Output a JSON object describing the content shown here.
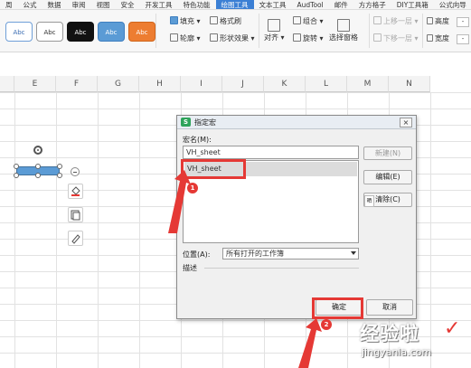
{
  "menubar": {
    "items": [
      "周",
      "公式",
      "数据",
      "审阅",
      "视图",
      "安全",
      "开发工具",
      "特色功能",
      "绘图工具",
      "文本工具",
      "AudTool",
      "邮件",
      "方方格子",
      "DIY工具箱",
      "公式向导"
    ],
    "active": "绘图工具"
  },
  "ribbon": {
    "style_presets": [
      {
        "label": "Abc",
        "bg": "#ffffff",
        "fg": "#3b6db3",
        "border": "#6f9fd8"
      },
      {
        "label": "Abc",
        "bg": "#ffffff",
        "fg": "#333333",
        "border": "#999999"
      },
      {
        "label": "Abc",
        "bg": "#111111",
        "fg": "#ffffff",
        "border": "#111111"
      },
      {
        "label": "Abc",
        "bg": "#5b9bd5",
        "fg": "#ffffff",
        "border": "#3f7fc0"
      },
      {
        "label": "Abc",
        "bg": "#ed7d31",
        "fg": "#ffffff",
        "border": "#d0651c"
      }
    ],
    "fill": "填充",
    "format_brush": "格式刷",
    "outline": "轮廓",
    "shape_effects": "形状效果",
    "align": "对齐",
    "group": "组合",
    "rotate": "旋转",
    "selection_pane": "选择窗格",
    "move_up": "上移一层",
    "move_down": "下移一层",
    "height": "高度",
    "width": "宽度",
    "height_value": "-",
    "width_value": "-"
  },
  "grid": {
    "columns": [
      "E",
      "F",
      "G",
      "H",
      "I",
      "J",
      "K",
      "L",
      "M",
      "N"
    ]
  },
  "dialog": {
    "title": "指定宏",
    "close": "×",
    "macro_name_label": "宏名(M):",
    "macro_name_value": "VH_sheet",
    "macro_list": [
      "VH_sheet"
    ],
    "new_button": "新建(N)",
    "edit_button": "编辑(E)",
    "delete_button": "清除(C)",
    "location_label": "位置(A):",
    "location_value": "所有打开的工作簿",
    "description_label": "描述",
    "ok_button": "确定",
    "cancel_button": "取消",
    "chip_text": "晒"
  },
  "annotations": {
    "badge1": "1",
    "badge2": "2",
    "highlight_color": "#e53935"
  },
  "watermark": {
    "title": "经验啦",
    "url": "jingyanla.com",
    "check": "✓"
  }
}
